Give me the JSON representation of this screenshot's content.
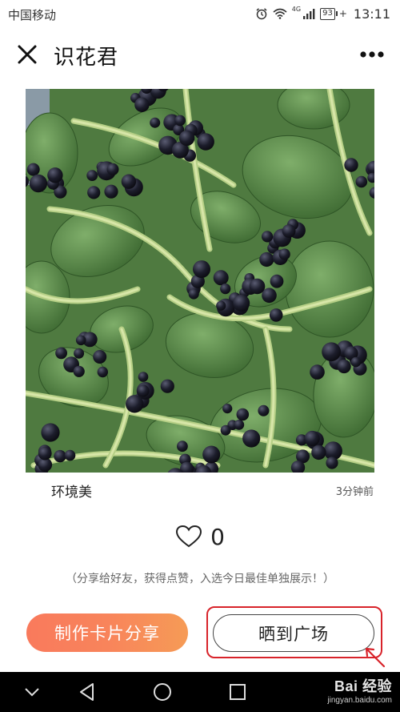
{
  "status_bar": {
    "carrier": "中国移动",
    "network": "4G",
    "battery": "93",
    "time": "13:11"
  },
  "header": {
    "title": "识花君",
    "close_icon": "close-icon",
    "more_icon": "more-dots-icon"
  },
  "post": {
    "image_subject": "black berries on green vine with oval leaves",
    "caption": "环境美",
    "time_ago": "3分钟前",
    "like_count": "0",
    "like_icon": "heart-outline-icon",
    "hint": "（分享给好友，获得点赞，入选今日最佳单独展示！）"
  },
  "actions": {
    "make_card": "制作卡片分享",
    "post_to_plaza": "晒到广场",
    "make_card_color": "#f88a5a",
    "highlight_color": "#d8232a"
  },
  "navbar": {
    "icons": [
      "chevron-down-icon",
      "back-icon",
      "home-icon",
      "recent-apps-icon"
    ]
  },
  "watermark": {
    "logo": "Bai 经验",
    "url": "jingyan.baidu.com"
  }
}
